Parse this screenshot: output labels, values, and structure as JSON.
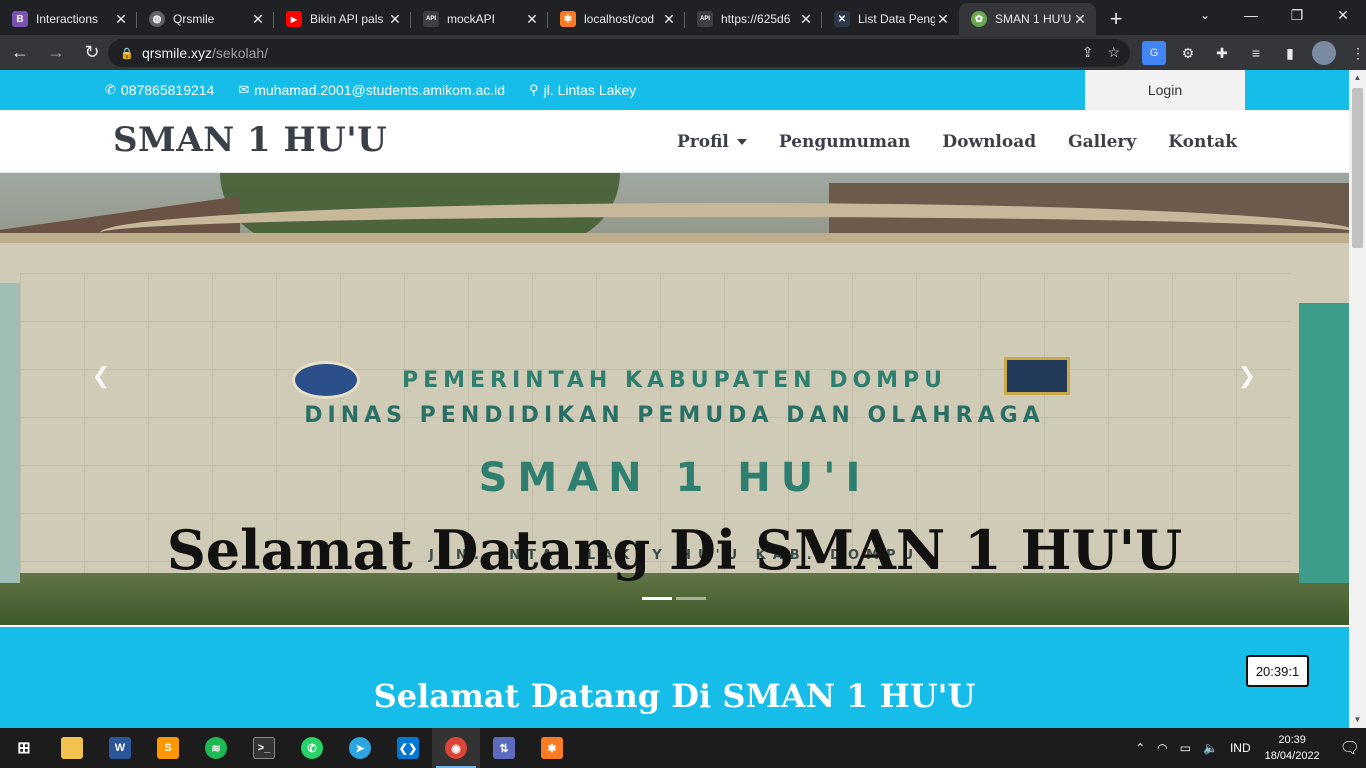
{
  "browser": {
    "tabs": [
      {
        "title": "Interactions",
        "fav_letter": "B",
        "fav_color": "#7952b3"
      },
      {
        "title": "Qrsmile",
        "fav_letter": "",
        "fav_color": "#5f6368"
      },
      {
        "title": "Bikin API pals",
        "fav_letter": "▶",
        "fav_color": "#ff0000"
      },
      {
        "title": "mockAPI",
        "fav_letter": "API",
        "fav_color": "#3c4043"
      },
      {
        "title": "localhost/cod",
        "fav_letter": "",
        "fav_color": "#fb7a24"
      },
      {
        "title": "https://625d6",
        "fav_letter": "API",
        "fav_color": "#3c4043"
      },
      {
        "title": "List Data Peng",
        "fav_letter": "",
        "fav_color": "#2d3748"
      },
      {
        "title": "SMAN 1 HU'U",
        "fav_letter": "",
        "fav_color": "#6aa84f",
        "active": true
      }
    ],
    "url_host": "qrsmile.xyz",
    "url_path": "/sekolah/"
  },
  "site": {
    "topbar": {
      "phone": "087865819214",
      "email": "muhamad.2001@students.amikom.ac.id",
      "address": "jl. Lintas Lakey",
      "login_label": "Login"
    },
    "brand": "SMAN 1 HU'U",
    "menu": {
      "profil": "Profil",
      "pengumuman": "Pengumuman",
      "download": "Download",
      "gallery": "Gallery",
      "kontak": "Kontak"
    },
    "hero": {
      "caption": "Selamat Datang Di SMAN 1 HU'U",
      "photo_line1": "PEMERINTAH KABUPATEN DOMPU",
      "photo_line2": "DINAS PENDIDIKAN PEMUDA DAN OLAHRAGA",
      "photo_line3": "SMAN 1 HU'I",
      "photo_line4": "JLN. INTAS LAKEY HU'U KAB. DOMPU",
      "slide_count": 2,
      "active_slide": 1
    },
    "welcome": {
      "heading": "Selamat Datang Di SMAN 1 HU'U",
      "clock": "20:39:1"
    }
  },
  "taskbar": {
    "tray_lang": "IND",
    "time": "20:39",
    "date": "18/04/2022"
  },
  "colors": {
    "accent": "#16bde8",
    "brand_text": "#3a3f48"
  }
}
